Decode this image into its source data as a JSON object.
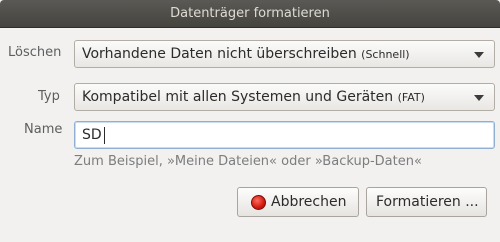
{
  "window": {
    "title": "Datenträger formatieren"
  },
  "erase": {
    "label": "Löschen",
    "value": "Vorhandene Daten nicht überschreiben",
    "value_suffix": "(Schnell)"
  },
  "type": {
    "label": "Typ",
    "value": "Kompatibel mit allen Systemen und Geräten",
    "value_suffix": "(FAT)"
  },
  "name": {
    "label": "Name",
    "value": "SD",
    "hint": "Zum Beispiel, »Meine Dateien« oder »Backup-Daten«"
  },
  "buttons": {
    "cancel_label": "Abbrechen",
    "cancel_icon": "stop-icon",
    "format_label": "Formatieren ..."
  },
  "colors": {
    "titlebar": "#4f4e4a",
    "background": "#f2f1f0",
    "stop_icon": "#d11a0f"
  }
}
